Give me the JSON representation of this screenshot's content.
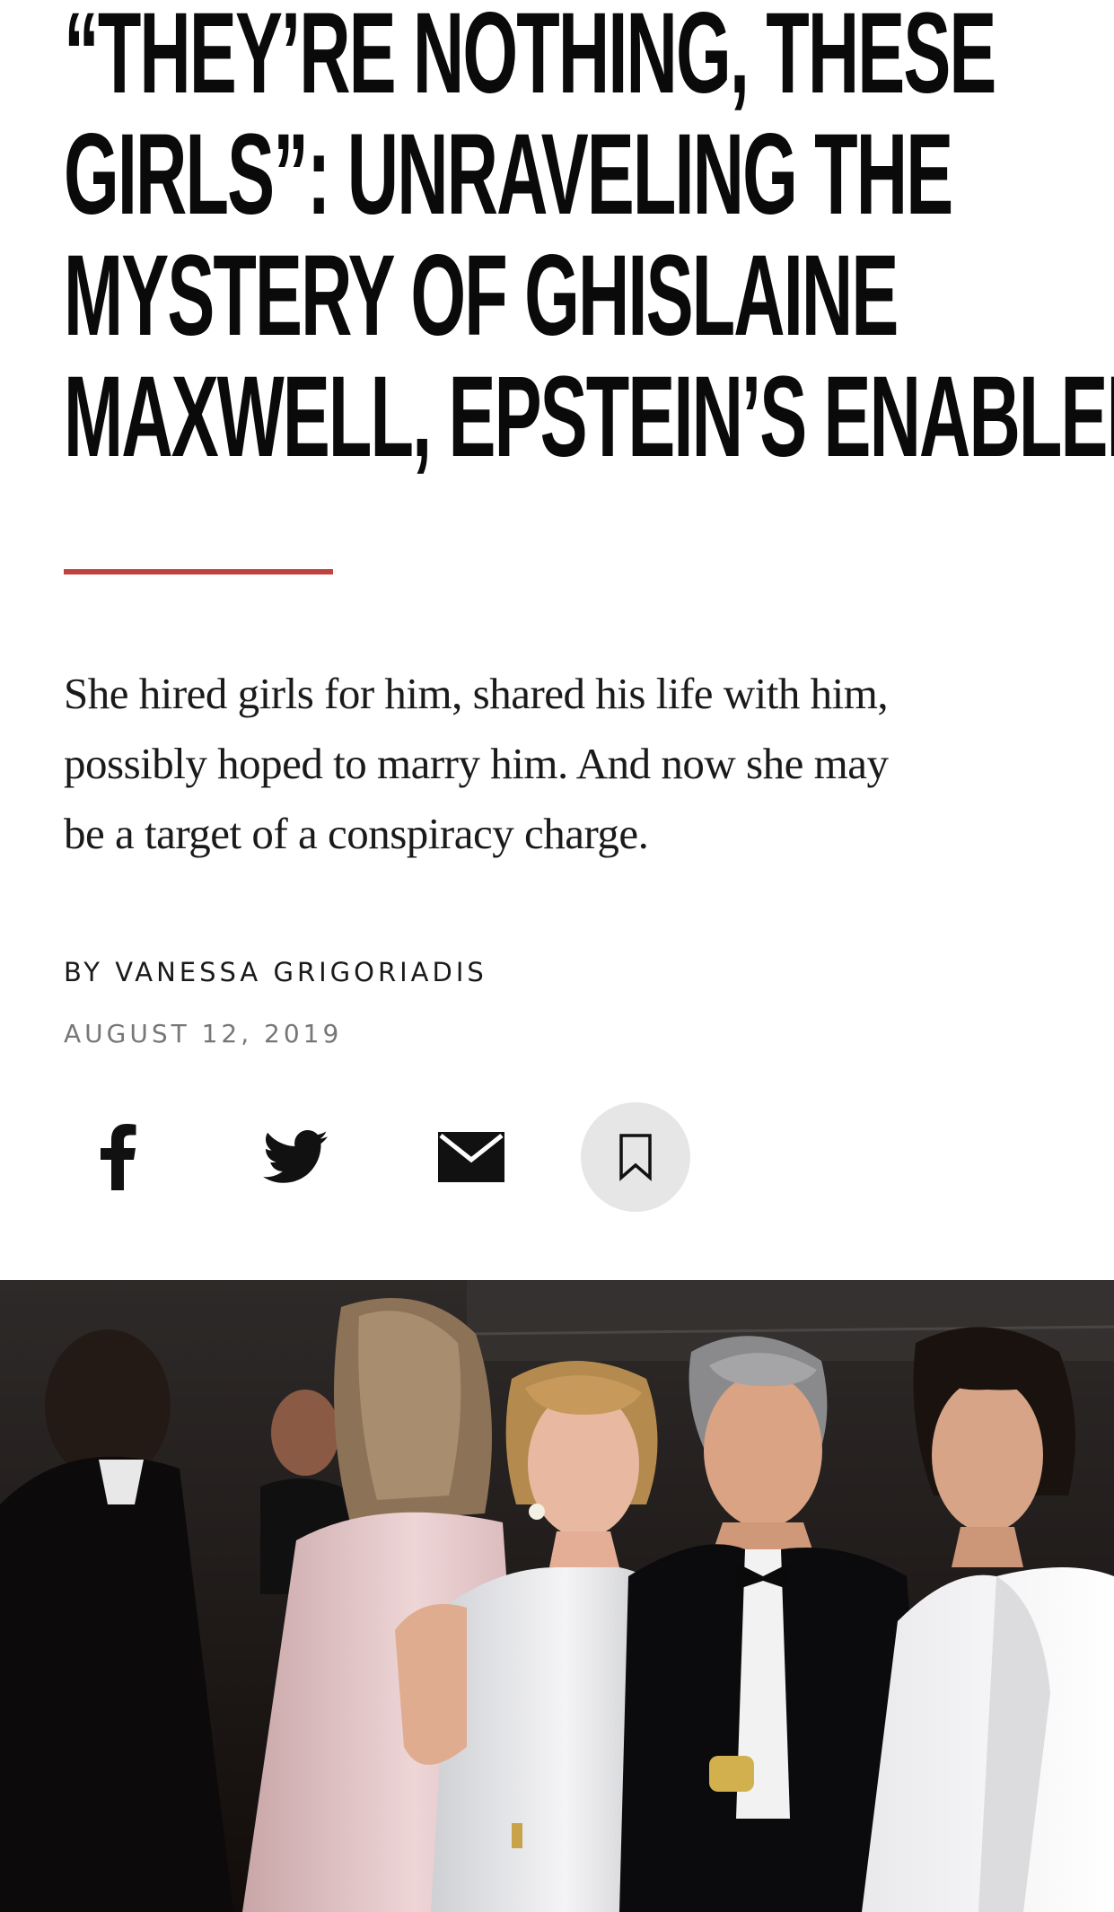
{
  "article": {
    "headline_lines": [
      "“They’re Nothing, These",
      "Girls”: Unraveling the",
      "Mystery of Ghislaine",
      "Maxwell, Epstein’s Enabler"
    ],
    "dek_lines": [
      "She hired girls for him, shared his life with him,",
      "possibly hoped to marry him. And now she may",
      "be a target of a conspiracy charge."
    ],
    "byline": "By Vanessa Grigoriadis",
    "date": "August 12, 2019"
  },
  "share": {
    "facebook_icon": "facebook-icon",
    "twitter_icon": "twitter-icon",
    "email_icon": "envelope-icon",
    "save_icon": "bookmark-icon"
  },
  "colors": {
    "accent_rule": "#c0433f",
    "save_button_bg": "#e6e6e6",
    "text": "#111111",
    "date_text": "#777777"
  },
  "hero_image": {
    "description_icon": "photo"
  }
}
